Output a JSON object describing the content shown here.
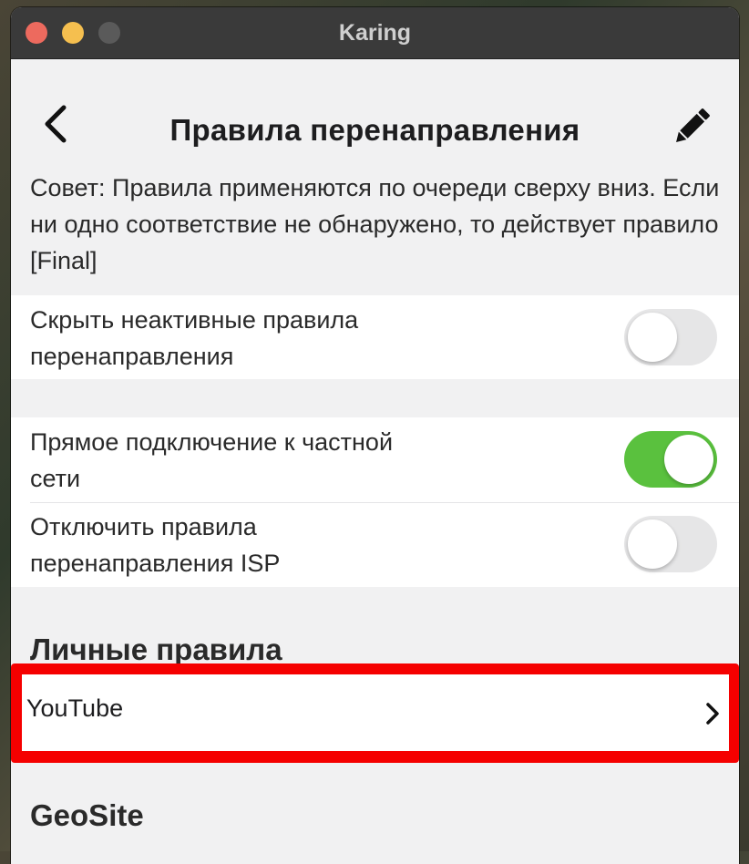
{
  "window": {
    "title": "Karing"
  },
  "header": {
    "title": "Правила перенаправления"
  },
  "tip": "Совет: Правила применяются по очереди сверху вниз. Если ни одно соответствие не обнаружено, то действует правило [Final]",
  "settings": {
    "hide_inactive": {
      "label_line1": "Скрыть неактивные правила",
      "label_line2": "перенаправления",
      "enabled": false
    },
    "direct_private": {
      "label_line1": "Прямое подключение к частной",
      "label_line2": "сети",
      "enabled": true
    },
    "disable_isp": {
      "label_line1": "Отключить правила",
      "label_line2": "перенаправления ISP",
      "enabled": false
    }
  },
  "personal_rules": {
    "heading": "Личные правила",
    "items": [
      {
        "label": "YouTube"
      }
    ]
  },
  "geosite": {
    "heading": "GeoSite"
  },
  "colors": {
    "toggle_on": "#5ac13e",
    "highlight": "#f50000",
    "titlebar": "#3a3a3a"
  },
  "icons": {
    "back": "chevron-left-icon",
    "edit": "pencil-icon",
    "item": "chevron-right-icon"
  }
}
